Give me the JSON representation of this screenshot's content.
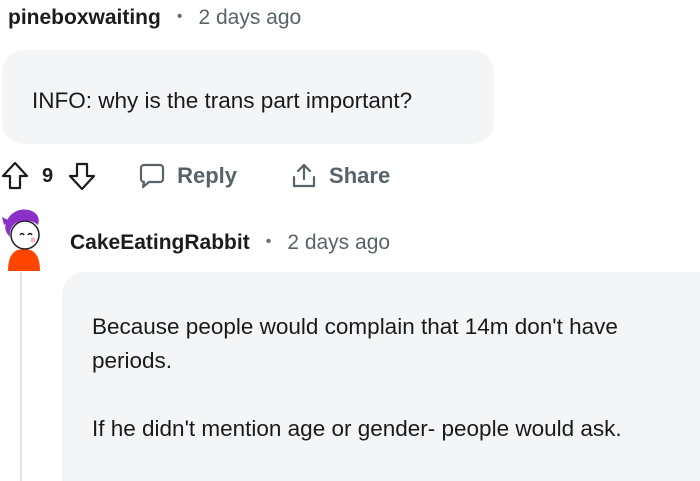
{
  "comment1": {
    "username": "pineboxwaiting",
    "separator": "•",
    "timestamp": "2 days ago",
    "body": "INFO: why is the trans part important?"
  },
  "actions": {
    "vote_count": "9",
    "reply_label": "Reply",
    "share_label": "Share",
    "icons": {
      "upvote": "upvote-arrow-icon",
      "downvote": "downvote-arrow-icon",
      "reply": "speech-bubble-icon",
      "share": "share-upload-icon"
    }
  },
  "comment2": {
    "username": "CakeEatingRabbit",
    "separator": "•",
    "timestamp": "2 days ago",
    "paragraphs": [
      "Because people would complain that 14m don't have periods.",
      "If he didn't mention age or gender- people would ask."
    ],
    "avatar_colors": {
      "hair": "#8b2fc9",
      "shirt": "#ff4500"
    }
  }
}
